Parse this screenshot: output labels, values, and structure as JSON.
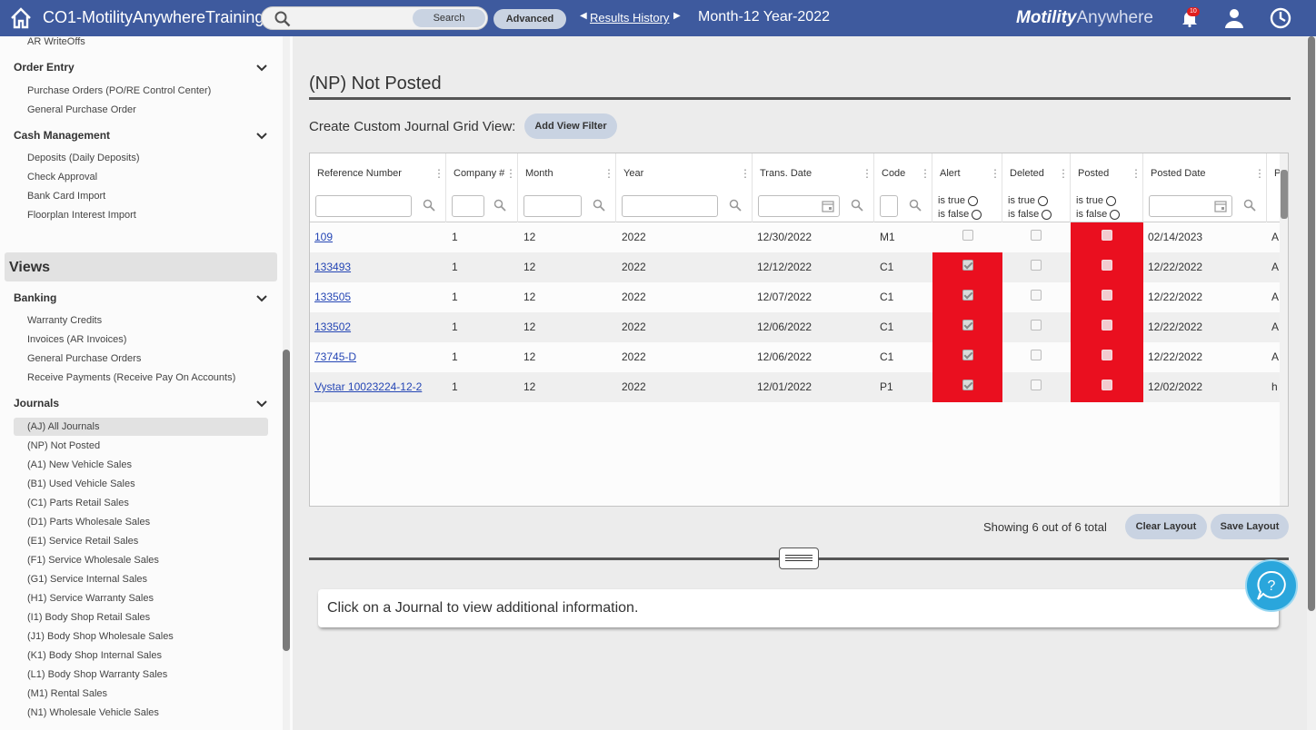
{
  "header": {
    "app_title": "CO1-MotilityAnywhereTraining",
    "search_button": "Search",
    "search_placeholder": "",
    "advanced_button": "Advanced",
    "results_history": "Results History",
    "period": "Month-12 Year-2022",
    "brand_bold": "Motility",
    "brand_light": "Anywhere",
    "notification_count": "10",
    "bar_color": "#3e5a9e"
  },
  "sidebar": {
    "top_item": "AR WriteOffs",
    "order_entry": {
      "title": "Order Entry",
      "items": [
        "Purchase Orders (PO/RE Control Center)",
        "General Purchase Order"
      ]
    },
    "cash_management": {
      "title": "Cash Management",
      "items": [
        "Deposits (Daily Deposits)",
        "Check Approval",
        "Bank Card Import",
        "Floorplan Interest Import"
      ]
    },
    "views_title": "Views",
    "banking": {
      "title": "Banking",
      "items": [
        "Warranty Credits",
        "Invoices (AR Invoices)",
        "General Purchase Orders",
        "Receive Payments (Receive Pay On Accounts)"
      ]
    },
    "journals": {
      "title": "Journals",
      "items": [
        "(AJ) All Journals",
        "(NP) Not Posted",
        "(A1) New Vehicle Sales",
        "(B1) Used Vehicle Sales",
        "(C1) Parts Retail Sales",
        "(D1) Parts Wholesale Sales",
        "(E1) Service Retail Sales",
        "(F1) Service Wholesale Sales",
        "(G1) Service Internal Sales",
        "(H1) Service Warranty Sales",
        "(I1) Body Shop Retail Sales",
        "(J1) Body Shop Wholesale Sales",
        "(K1) Body Shop Internal Sales",
        "(L1) Body Shop Warranty Sales",
        "(M1) Rental Sales",
        "(N1) Wholesale Vehicle Sales"
      ]
    }
  },
  "main": {
    "page_title": "(NP) Not Posted",
    "custom_label": "Create Custom Journal Grid View:",
    "add_filter": "Add View Filter",
    "columns": [
      "Reference Number",
      "Company #",
      "Month",
      "Year",
      "Trans. Date",
      "Code",
      "Alert",
      "Deleted",
      "Posted",
      "Posted Date",
      "P"
    ],
    "bool_true": "is true",
    "bool_false": "is false",
    "rows": [
      {
        "ref": "109",
        "company": "1",
        "month": "12",
        "year": "2022",
        "trans_date": "12/30/2022",
        "code": "M1",
        "alert": false,
        "deleted": false,
        "posted": false,
        "posted_date": "02/14/2023",
        "p": "A"
      },
      {
        "ref": "133493",
        "company": "1",
        "month": "12",
        "year": "2022",
        "trans_date": "12/12/2022",
        "code": "C1",
        "alert": true,
        "deleted": false,
        "posted": false,
        "posted_date": "12/22/2022",
        "p": "A"
      },
      {
        "ref": "133505",
        "company": "1",
        "month": "12",
        "year": "2022",
        "trans_date": "12/07/2022",
        "code": "C1",
        "alert": true,
        "deleted": false,
        "posted": false,
        "posted_date": "12/22/2022",
        "p": "A"
      },
      {
        "ref": "133502",
        "company": "1",
        "month": "12",
        "year": "2022",
        "trans_date": "12/06/2022",
        "code": "C1",
        "alert": true,
        "deleted": false,
        "posted": false,
        "posted_date": "12/22/2022",
        "p": "A"
      },
      {
        "ref": "73745-D",
        "company": "1",
        "month": "12",
        "year": "2022",
        "trans_date": "12/06/2022",
        "code": "C1",
        "alert": true,
        "deleted": false,
        "posted": false,
        "posted_date": "12/22/2022",
        "p": "A"
      },
      {
        "ref": "Vystar 10023224-12-2",
        "company": "1",
        "month": "12",
        "year": "2022",
        "trans_date": "12/01/2022",
        "code": "P1",
        "alert": true,
        "deleted": false,
        "posted": false,
        "posted_date": "12/02/2022",
        "p": "h"
      }
    ],
    "showing": "Showing 6 out of 6 total",
    "clear_layout": "Clear Layout",
    "save_layout": "Save Layout",
    "info_text": "Click on a Journal to view additional information.",
    "highlight_color": "#ea0f1f"
  }
}
